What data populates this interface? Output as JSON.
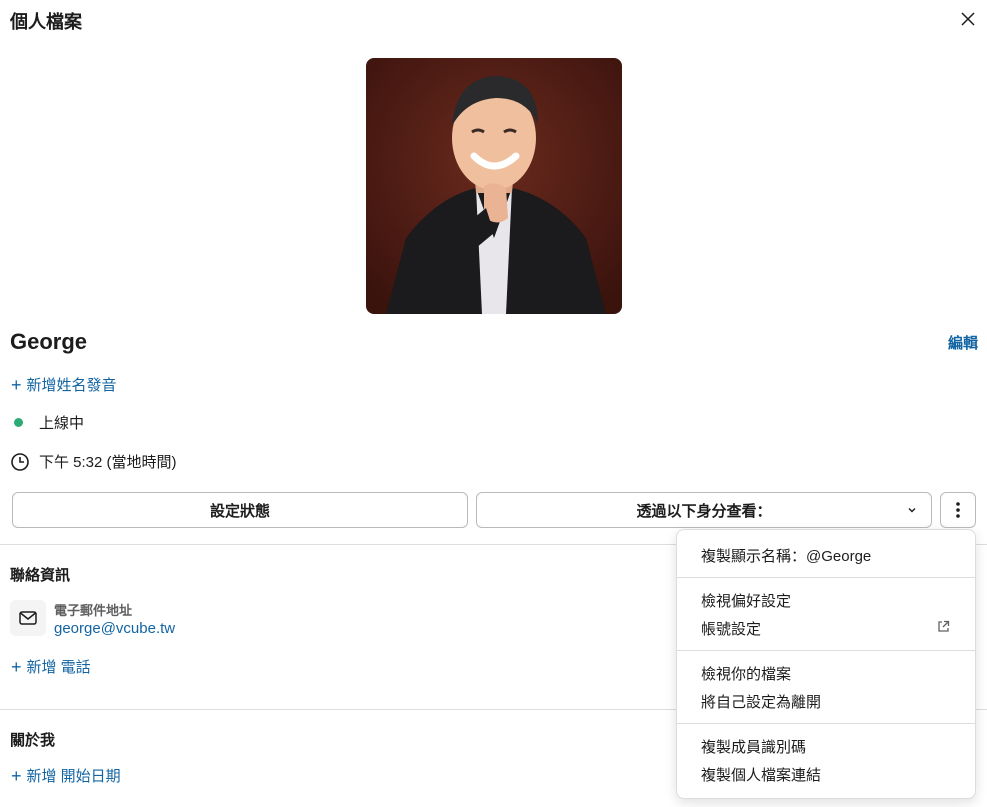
{
  "header": {
    "title": "個人檔案",
    "close_icon": "close-icon"
  },
  "profile": {
    "display_name": "George",
    "edit_label": "編輯",
    "add_pronunciation": "新增姓名發音",
    "status": "上線中",
    "status_color": "#2bac76",
    "local_time": "下午 5:32 (當地時間)"
  },
  "actions": {
    "set_status": "設定狀態",
    "view_as": "透過以下身分查看："
  },
  "contact": {
    "title": "聯絡資訊",
    "email_label": "電子郵件地址",
    "email_value": "george@vcube.tw",
    "add_phone": "新增 電話"
  },
  "about": {
    "title": "關於我",
    "add_start_date": "新增 開始日期"
  },
  "menu": {
    "copy_display_name": "複製顯示名稱：@George",
    "view_preferences": "檢視偏好設定",
    "account_settings": "帳號設定",
    "view_your_profile": "檢視你的檔案",
    "set_away": "將自己設定為離開",
    "copy_member_id": "複製成員識別碼",
    "copy_profile_link": "複製個人檔案連結"
  },
  "colors": {
    "link": "#1264a3",
    "text": "#1d1c1d"
  }
}
